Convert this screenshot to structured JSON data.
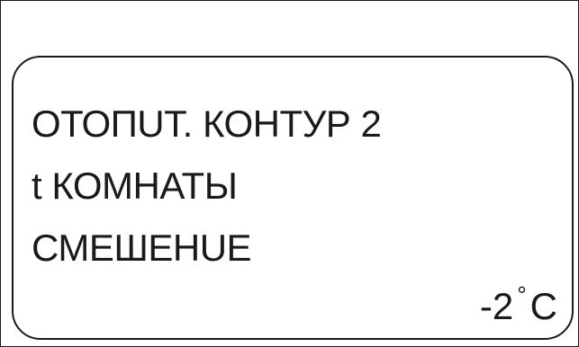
{
  "display": {
    "line1": "ОТОПUТ. КОНТУР 2",
    "line2": "t КОМНАТЫ",
    "line3": "СМЕШЕНUЕ",
    "value": {
      "number": "-2",
      "degree_symbol": "°",
      "unit": "C"
    }
  }
}
